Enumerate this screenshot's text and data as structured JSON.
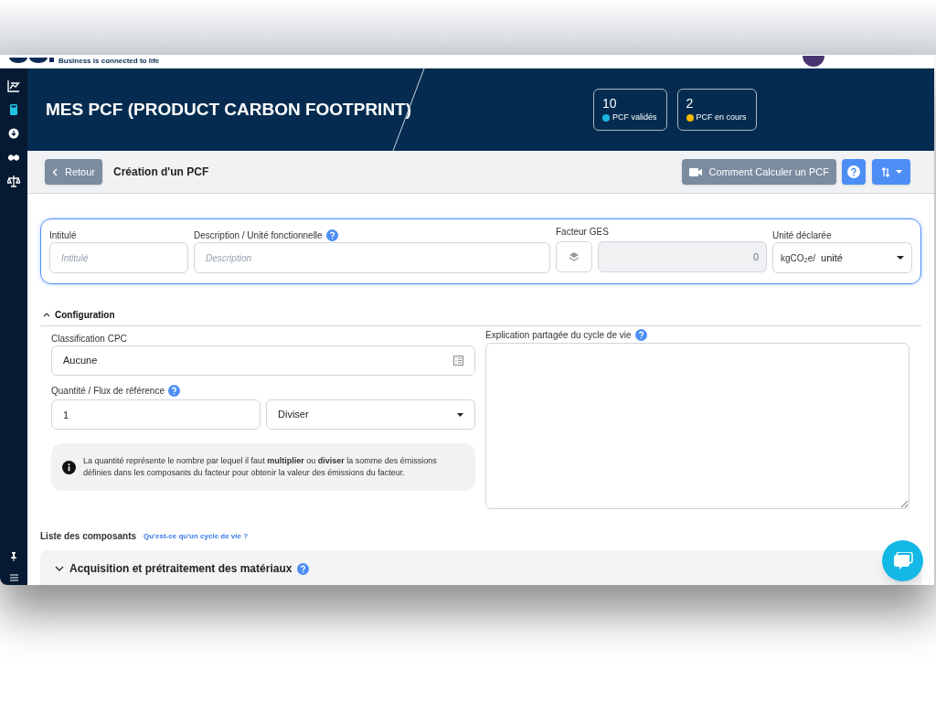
{
  "brand": {
    "tagline": "Business is connected to life"
  },
  "sidebar": {
    "items": [
      {
        "selected": false
      },
      {
        "selected": true
      },
      {
        "selected": false
      },
      {
        "selected": false
      },
      {
        "selected": false
      }
    ]
  },
  "header": {
    "title": "MES PCF (PRODUCT CARBON FOOTPRINT)",
    "stats": [
      {
        "value": "10",
        "label": "PCF validés",
        "color": "#1bb5e0"
      },
      {
        "value": "2",
        "label": "PCF en cours",
        "color": "#f5b800"
      }
    ]
  },
  "toolbar": {
    "back": "Retour",
    "title": "Création d'un PCF",
    "video_button": "Comment Calculer un PCF"
  },
  "identity": {
    "name_label": "Intitulé",
    "name_placeholder": "Intitulé",
    "description_label": "Description / Unité fonctionnelle",
    "description_placeholder": "Description",
    "factor_label": "Facteur GES",
    "factor_value": "0",
    "unit_label": "Unité déclarée",
    "unit_prefix": "kgCO$_{2}$e/",
    "unit_value": "unité"
  },
  "configuration": {
    "title": "Configuration",
    "expanded": true,
    "classification_label": "Classification CPC",
    "classification_value": "Aucune",
    "quantity_label": "Quantité / Flux de référence",
    "quantity_value": "1",
    "operation": "Diviser",
    "info": "La quantité représente le nombre par lequel il faut **multiplier** ou **diviser** la somme des émissions définies dans les composants du facteur pour obtenir la valeur des émissions du facteur.",
    "explanation_label": "Explication partagée du cycle de vie"
  },
  "components": {
    "title": "Liste des composants",
    "link": "Qu'est-ce qu'un cycle de vie ?",
    "sections": [
      {
        "title": "Acquisition et prétraitement des matériaux",
        "expanded": false
      }
    ]
  }
}
